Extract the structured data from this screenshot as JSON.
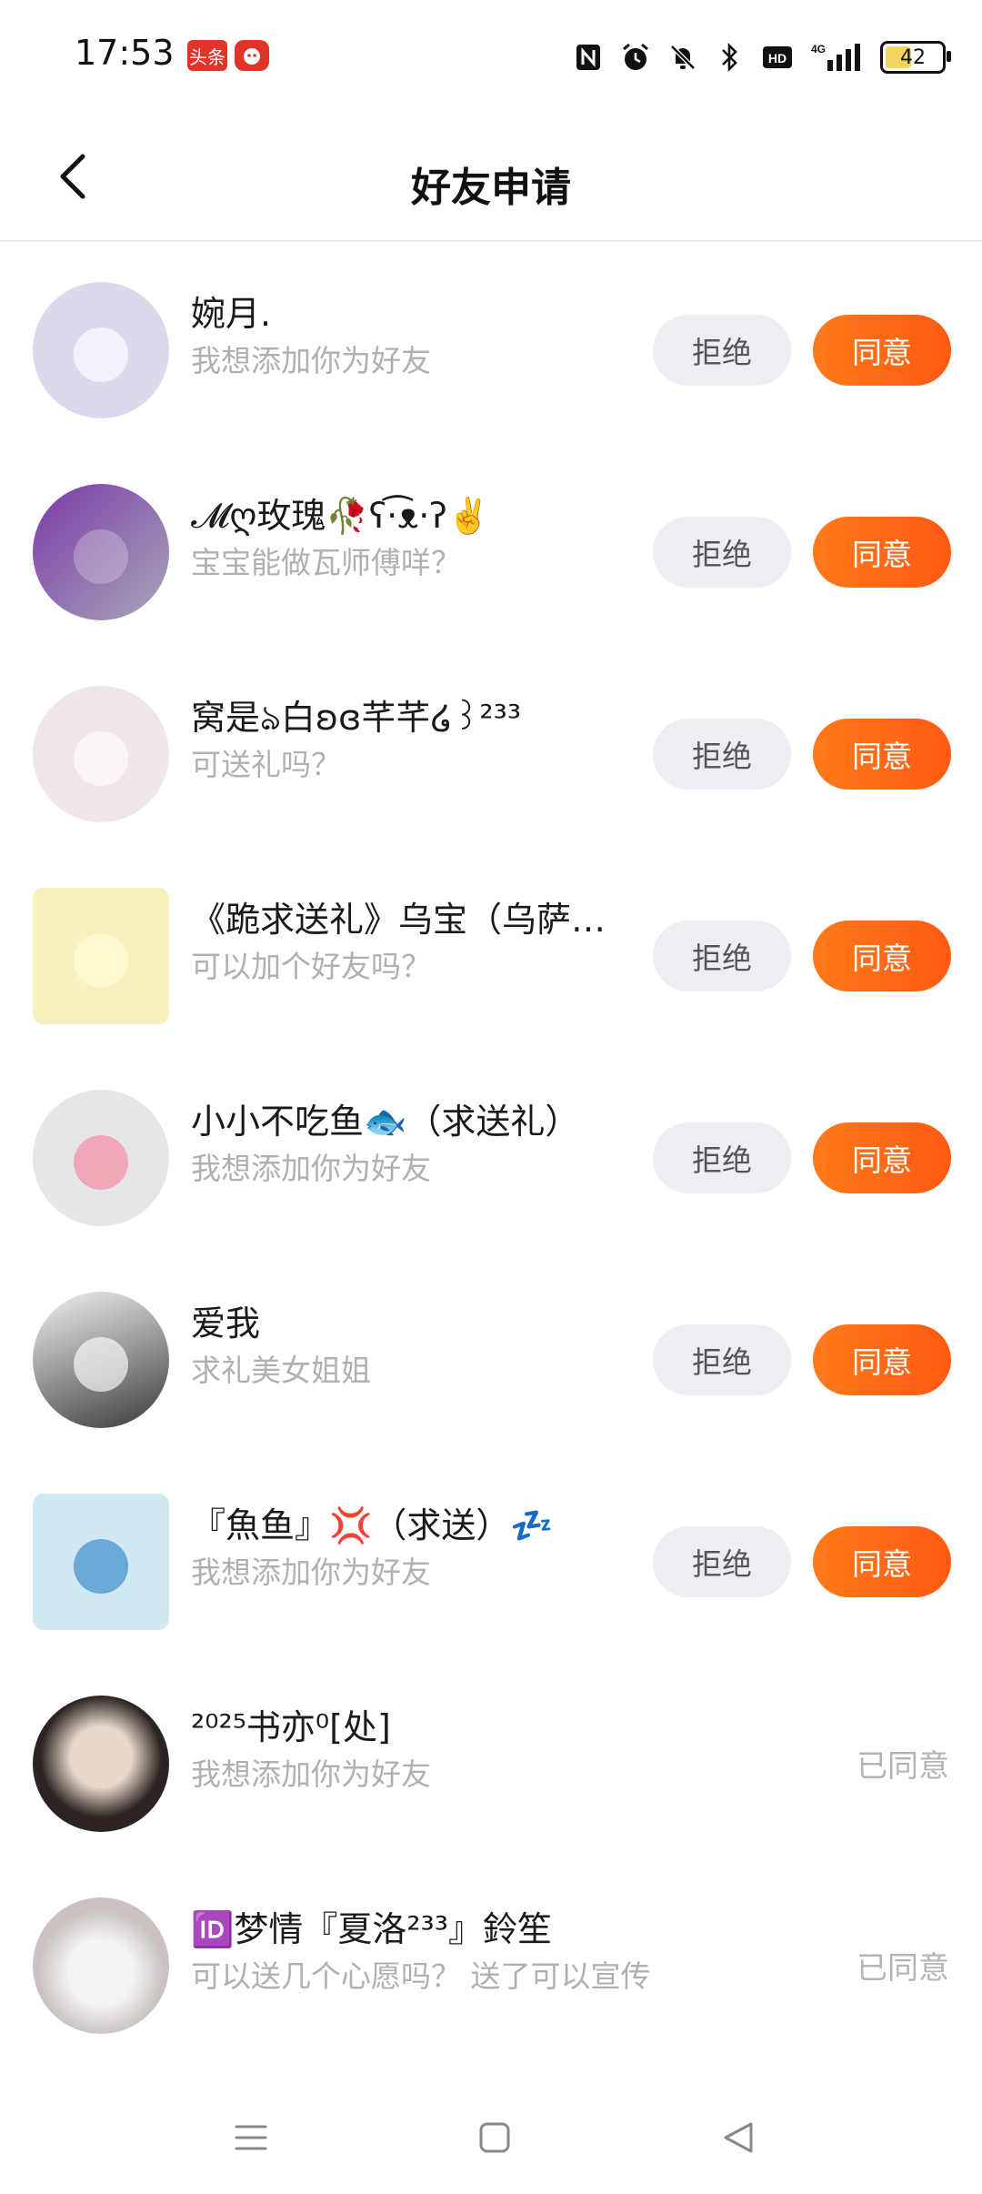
{
  "status_bar": {
    "time": "17:53",
    "badge1": "头条",
    "badge2": "",
    "battery_level": "42"
  },
  "header": {
    "title": "好友申请"
  },
  "requests": [
    {
      "name": "婉月.",
      "message": "我想添加你为好友",
      "state": "pending",
      "avatar_color": "#dcd8ee"
    },
    {
      "name": "𝓜ღ玫瑰🥀ʕ·͡ᴥ·ʔ✌️",
      "message": "宝宝能做瓦师傅咩？",
      "state": "pending",
      "avatar_color": "#7a3aa8"
    },
    {
      "name": "窝是ঌ白ʚɞ芊芊໒꒱²³³",
      "message": "可送礼吗？",
      "state": "pending",
      "avatar_color": "#efe6ea"
    },
    {
      "name": "《跪求送礼》乌宝（乌萨…",
      "message": "可以加个好友吗？",
      "state": "pending",
      "avatar_color": "#f7f0bf"
    },
    {
      "name": "小小不吃鱼🐟（求送礼）",
      "message": "我想添加你为好友",
      "state": "pending",
      "avatar_color": "#e6e6e6"
    },
    {
      "name": "爱我",
      "message": "求礼美女姐姐",
      "state": "pending",
      "avatar_color": "#3a3a3a"
    },
    {
      "name": "『魚鱼』💢（求送）💤",
      "message": "我想添加你为好友",
      "state": "pending",
      "avatar_color": "#cfe8f2"
    },
    {
      "name": "²⁰²⁵书亦⁰[处]",
      "message": "我想添加你为好友",
      "state": "agreed",
      "avatar_color": "#2b2420"
    },
    {
      "name": "🆔梦情『夏洛²³³』鈴笙",
      "message": "可以送几个心愿吗？ 送了可以宣传",
      "state": "agreed",
      "avatar_color": "#c9c2c0"
    }
  ],
  "labels": {
    "reject": "拒绝",
    "agree": "同意",
    "agreed": "已同意"
  },
  "colors": {
    "accent": "#ff6a16",
    "reject_bg": "#eceef3",
    "muted_text": "#b0b0b0"
  },
  "icons": [
    "nfc-icon",
    "alarm-icon",
    "mute-icon",
    "bluetooth-icon",
    "hd-icon",
    "signal-4g-icon",
    "battery-icon",
    "back-icon",
    "menu-icon",
    "home-icon",
    "nav-back-icon"
  ]
}
